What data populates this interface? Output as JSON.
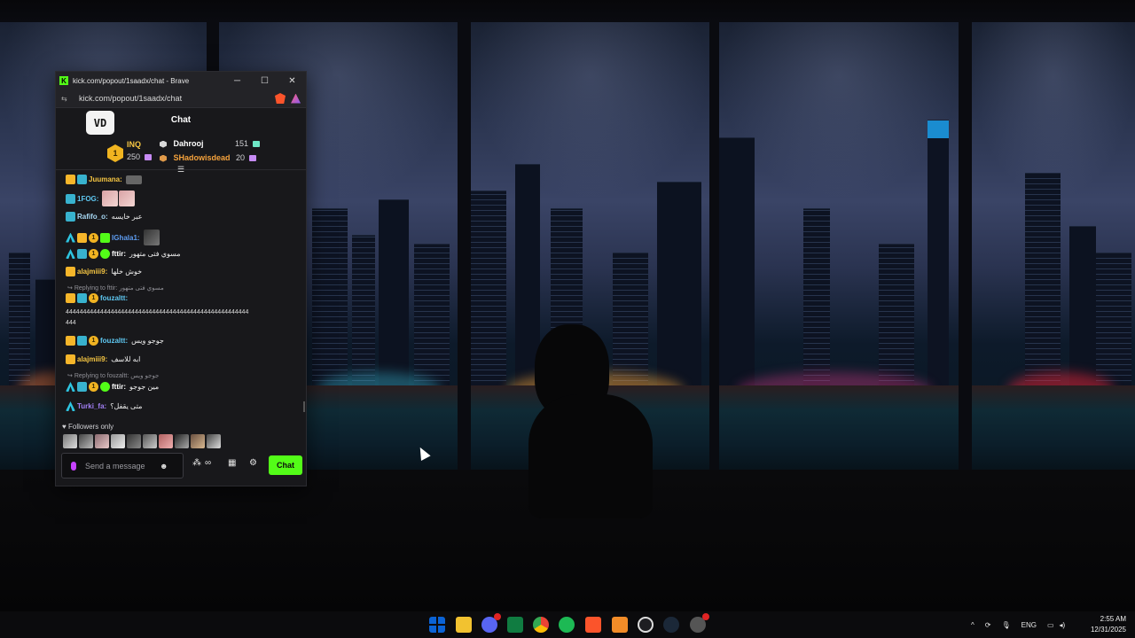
{
  "browser": {
    "window_title": "kick.com/popout/1saadx/chat - Brave",
    "url": "kick.com/popout/1saadx/chat",
    "favicon_letter": "K",
    "minimize": "─",
    "maximize": "☐",
    "close": "✕"
  },
  "chat": {
    "header_title": "Chat",
    "channel_logo": "VD",
    "leaderboard": {
      "first": {
        "rank": "1",
        "name": "INQ",
        "amount": "250"
      },
      "second": {
        "name": "Dahrooj",
        "amount": "151"
      },
      "third": {
        "name": "SHadowisdead",
        "amount": "20"
      }
    },
    "messages": [
      {
        "user": "Juumana:",
        "text": "",
        "color": "#f5c542"
      },
      {
        "user": "1FOG:",
        "text": "",
        "color": "#5ec8f2"
      },
      {
        "user": "Rafifo_o:",
        "text": "عبر خايسه",
        "color": "#a8d9f5"
      },
      {
        "user": "IGhala1:",
        "text": "",
        "color": "#5e9df2"
      },
      {
        "user": "fttir:",
        "text": "مسوي فتى متهور",
        "color": "#ffffff"
      },
      {
        "user": "alajmiii9:",
        "text": "خوش خلها",
        "color": "#f5c542"
      },
      {
        "user": "fouzaltt:",
        "text": "",
        "color": "#5ec8f2"
      },
      {
        "user": "fouzaltt:",
        "text": "جوجو ويس",
        "color": "#5ec8f2"
      },
      {
        "user": "alajmiii9:",
        "text": "ابه للاسف",
        "color": "#f5c542"
      },
      {
        "user": "fttir:",
        "text": "مين جوجو",
        "color": "#ffffff"
      },
      {
        "user": "Turki_fa:",
        "text": "متى يقفل؟",
        "color": "#a27ff5"
      }
    ],
    "replies": [
      {
        "prefix": "Replying to fttir:",
        "quote": "مسوي فتى متهور"
      },
      {
        "prefix": "Replying to fouzaltt:",
        "quote": "جوجو ويس"
      }
    ],
    "spam_line": "44444444444444444444444444444444444444444444444444444",
    "spam_tail": "444",
    "followers_only": "Followers only",
    "input_placeholder": "Send a message",
    "send_button": "Chat"
  },
  "taskbar": {
    "language": "ENG",
    "time": "2:55 AM",
    "date": "12/31/2025"
  },
  "colors": {
    "kick_green": "#53fc18",
    "panel_bg": "#18181b",
    "taskbar_bg": "#0b0b0d"
  }
}
